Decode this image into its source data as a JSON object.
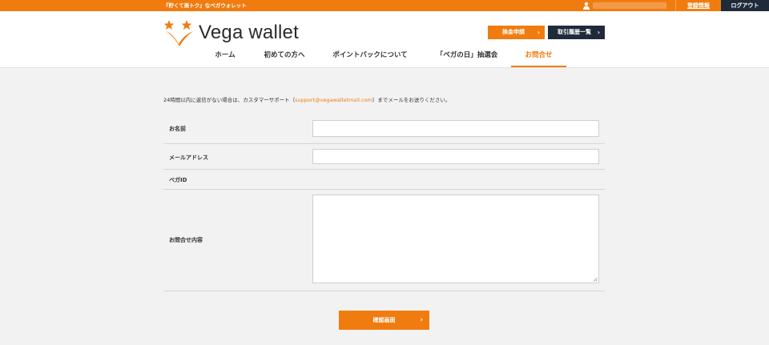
{
  "topbar": {
    "tagline": "『貯くて楽トク』なベガウォレット",
    "account_label": "登録情報",
    "logout_label": "ログアウト",
    "colors": {
      "orange": "#f07c10",
      "navy": "#1f2a3a"
    }
  },
  "header": {
    "logo_text": "Vega wallet",
    "exchange_label": "換金申請",
    "history_label": "取引履歴一覧",
    "nav": [
      {
        "label": "ホーム"
      },
      {
        "label": "初めての方へ"
      },
      {
        "label": "ポイントバックについて"
      },
      {
        "label": "「ベガの日」抽選会"
      },
      {
        "label": "お問合せ",
        "active": true
      }
    ]
  },
  "notice": {
    "prefix": "24時間以内に返信がない場合は、カスタマーサポート（",
    "email": "support@vegawalletmail.com",
    "suffix": "）までメールをお送りください。"
  },
  "form": {
    "name_label": "お名前",
    "name_value": "",
    "email_label": "メールアドレス",
    "email_value": "",
    "vega_id_label": "ベガID",
    "vega_id_value": "",
    "message_label": "お問合せ内容",
    "message_value": "",
    "submit_label": "確認画面"
  },
  "icons": [
    "user-icon",
    "star-logo-icon",
    "chevron-right-icon",
    "resize-handle-icon"
  ]
}
